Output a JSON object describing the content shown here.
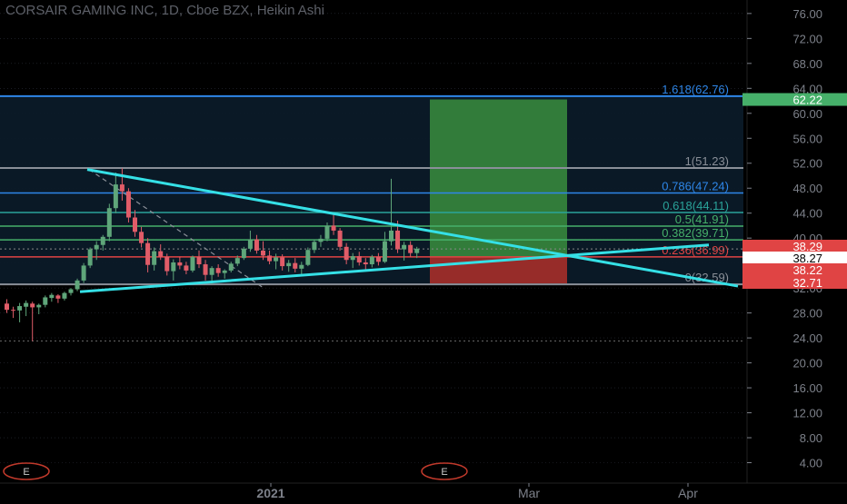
{
  "title": "CORSAIR GAMING INC, 1D, Cboe BZX, Heikin Ashi",
  "colors": {
    "background": "#000000",
    "up_candle": "#5fa67a",
    "down_candle": "#e05c68",
    "trendline": "#35e0e6",
    "fib_blue": "#2e86e8",
    "fib_gray": "#8a8f98",
    "fib_teal": "#2aa39a",
    "fib_green": "#46b06a",
    "fib_red": "#e04444",
    "target_zone": "#3a8e3e",
    "stop_zone": "#b0302a",
    "axis_text": "#7d818a",
    "grid": "#2a2e39"
  },
  "chart_data": {
    "type": "candlestick",
    "title": "CORSAIR GAMING INC, 1D, Cboe BZX, Heikin Ashi",
    "y_axis": {
      "ticks": [
        "76.00",
        "72.00",
        "68.00",
        "64.00",
        "60.00",
        "56.00",
        "52.00",
        "48.00",
        "44.00",
        "40.00",
        "36.00",
        "32.00",
        "28.00",
        "24.00",
        "20.00",
        "16.00",
        "12.00",
        "8.00",
        "4.00"
      ],
      "range": [
        0,
        78
      ]
    },
    "x_axis": {
      "ticks": [
        "2021",
        "Mar",
        "Apr"
      ]
    },
    "price_labels": [
      {
        "text": "62.22",
        "value": 62.22,
        "color": "#46b06a",
        "text_color": "#ffffff"
      },
      {
        "text": "38.29",
        "value": 38.29,
        "color": "#e04444",
        "text_color": "#ffffff"
      },
      {
        "text": "38.27",
        "value": 38.27,
        "color": "#ffffff",
        "text_color": "#000000"
      },
      {
        "text": "38.22",
        "value": 38.22,
        "color": "#e04444",
        "text_color": "#ffffff"
      },
      {
        "text": "32.71",
        "value": 32.71,
        "color": "#e04444",
        "text_color": "#ffffff"
      }
    ],
    "fib_levels": [
      {
        "label": "1.618(62.76)",
        "value": 62.76,
        "color": "#2e86e8"
      },
      {
        "label": "1(51.23)",
        "value": 51.23,
        "color": "#8a8f98"
      },
      {
        "label": "0.786(47.24)",
        "value": 47.24,
        "color": "#2e86e8"
      },
      {
        "label": "0.618(44.11)",
        "value": 44.11,
        "color": "#2aa39a"
      },
      {
        "label": "0.5(41.91)",
        "value": 41.91,
        "color": "#46b06a"
      },
      {
        "label": "0.382(39.71)",
        "value": 39.71,
        "color": "#46b06a"
      },
      {
        "label": "0.236(36.99)",
        "value": 36.99,
        "color": "#e04444"
      },
      {
        "label": "0(32.59)",
        "value": 32.59,
        "color": "#8a8f98"
      }
    ],
    "position": {
      "entry": 36.99,
      "target": 62.22,
      "stop": 32.71
    },
    "earnings_markers": [
      "E",
      "E"
    ],
    "candles": [
      {
        "o": 29.5,
        "h": 30.2,
        "l": 28.0,
        "c": 28.5
      },
      {
        "o": 28.5,
        "h": 29.0,
        "l": 27.2,
        "c": 28.4
      },
      {
        "o": 28.4,
        "h": 29.6,
        "l": 26.5,
        "c": 29.1
      },
      {
        "o": 29.0,
        "h": 30.0,
        "l": 27.5,
        "c": 29.6
      },
      {
        "o": 29.5,
        "h": 29.8,
        "l": 23.5,
        "c": 28.9
      },
      {
        "o": 28.9,
        "h": 29.5,
        "l": 27.8,
        "c": 29.3
      },
      {
        "o": 29.3,
        "h": 30.8,
        "l": 28.9,
        "c": 30.5
      },
      {
        "o": 30.4,
        "h": 31.2,
        "l": 29.8,
        "c": 30.9
      },
      {
        "o": 30.8,
        "h": 31.0,
        "l": 29.6,
        "c": 30.3
      },
      {
        "o": 30.3,
        "h": 31.4,
        "l": 30.0,
        "c": 31.2
      },
      {
        "o": 31.2,
        "h": 32.0,
        "l": 30.8,
        "c": 31.8
      },
      {
        "o": 31.8,
        "h": 33.5,
        "l": 31.5,
        "c": 33.2
      },
      {
        "o": 33.2,
        "h": 36.0,
        "l": 32.8,
        "c": 35.6
      },
      {
        "o": 35.6,
        "h": 38.5,
        "l": 35.2,
        "c": 38.2
      },
      {
        "o": 38.2,
        "h": 39.5,
        "l": 36.5,
        "c": 38.9
      },
      {
        "o": 38.9,
        "h": 40.5,
        "l": 38.0,
        "c": 40.2
      },
      {
        "o": 40.2,
        "h": 45.5,
        "l": 39.5,
        "c": 44.8
      },
      {
        "o": 44.8,
        "h": 50.5,
        "l": 44.0,
        "c": 48.6
      },
      {
        "o": 48.6,
        "h": 51.2,
        "l": 46.0,
        "c": 47.5
      },
      {
        "o": 47.5,
        "h": 48.0,
        "l": 42.5,
        "c": 43.3
      },
      {
        "o": 43.3,
        "h": 44.5,
        "l": 40.2,
        "c": 41.0
      },
      {
        "o": 41.0,
        "h": 41.8,
        "l": 38.5,
        "c": 39.2
      },
      {
        "o": 39.2,
        "h": 40.0,
        "l": 34.5,
        "c": 35.7
      },
      {
        "o": 35.7,
        "h": 38.5,
        "l": 34.8,
        "c": 37.9
      },
      {
        "o": 37.9,
        "h": 39.0,
        "l": 36.5,
        "c": 37.0
      },
      {
        "o": 37.0,
        "h": 37.5,
        "l": 34.0,
        "c": 34.7
      },
      {
        "o": 34.7,
        "h": 36.6,
        "l": 33.2,
        "c": 36.1
      },
      {
        "o": 36.1,
        "h": 37.0,
        "l": 35.0,
        "c": 35.6
      },
      {
        "o": 35.6,
        "h": 36.2,
        "l": 34.2,
        "c": 34.8
      },
      {
        "o": 34.8,
        "h": 37.2,
        "l": 34.5,
        "c": 37.0
      },
      {
        "o": 37.0,
        "h": 38.0,
        "l": 35.2,
        "c": 35.8
      },
      {
        "o": 35.8,
        "h": 36.5,
        "l": 33.2,
        "c": 34.1
      },
      {
        "o": 34.1,
        "h": 35.5,
        "l": 32.6,
        "c": 35.2
      },
      {
        "o": 35.2,
        "h": 35.8,
        "l": 33.8,
        "c": 34.4
      },
      {
        "o": 34.4,
        "h": 35.0,
        "l": 33.5,
        "c": 34.8
      },
      {
        "o": 34.8,
        "h": 36.2,
        "l": 34.5,
        "c": 35.9
      },
      {
        "o": 35.9,
        "h": 37.2,
        "l": 35.5,
        "c": 36.8
      },
      {
        "o": 36.8,
        "h": 38.6,
        "l": 36.5,
        "c": 38.3
      },
      {
        "o": 38.3,
        "h": 41.2,
        "l": 37.8,
        "c": 39.8
      },
      {
        "o": 39.8,
        "h": 40.5,
        "l": 37.5,
        "c": 38.0
      },
      {
        "o": 38.0,
        "h": 39.5,
        "l": 36.5,
        "c": 37.2
      },
      {
        "o": 37.2,
        "h": 38.0,
        "l": 35.8,
        "c": 36.3
      },
      {
        "o": 36.3,
        "h": 37.5,
        "l": 35.0,
        "c": 36.9
      },
      {
        "o": 36.9,
        "h": 37.4,
        "l": 34.8,
        "c": 35.5
      },
      {
        "o": 35.5,
        "h": 36.5,
        "l": 34.6,
        "c": 36.0
      },
      {
        "o": 36.0,
        "h": 36.8,
        "l": 34.5,
        "c": 35.1
      },
      {
        "o": 35.1,
        "h": 36.2,
        "l": 34.0,
        "c": 35.7
      },
      {
        "o": 35.7,
        "h": 38.5,
        "l": 35.5,
        "c": 38.1
      },
      {
        "o": 38.1,
        "h": 39.8,
        "l": 37.6,
        "c": 39.4
      },
      {
        "o": 39.4,
        "h": 40.5,
        "l": 38.6,
        "c": 39.9
      },
      {
        "o": 39.9,
        "h": 42.5,
        "l": 39.5,
        "c": 42.0
      },
      {
        "o": 42.0,
        "h": 43.8,
        "l": 40.5,
        "c": 41.2
      },
      {
        "o": 41.2,
        "h": 41.6,
        "l": 38.0,
        "c": 38.6
      },
      {
        "o": 38.6,
        "h": 39.2,
        "l": 35.8,
        "c": 36.5
      },
      {
        "o": 36.5,
        "h": 37.6,
        "l": 35.2,
        "c": 37.1
      },
      {
        "o": 37.1,
        "h": 37.8,
        "l": 35.6,
        "c": 36.1
      },
      {
        "o": 36.1,
        "h": 36.8,
        "l": 35.0,
        "c": 35.8
      },
      {
        "o": 35.8,
        "h": 37.3,
        "l": 35.3,
        "c": 37.0
      },
      {
        "o": 37.0,
        "h": 37.6,
        "l": 35.6,
        "c": 36.2
      },
      {
        "o": 36.2,
        "h": 41.0,
        "l": 36.0,
        "c": 39.5
      },
      {
        "o": 39.5,
        "h": 49.5,
        "l": 38.8,
        "c": 41.2
      },
      {
        "o": 41.2,
        "h": 42.8,
        "l": 37.6,
        "c": 38.2
      },
      {
        "o": 38.2,
        "h": 39.4,
        "l": 36.4,
        "c": 38.9
      },
      {
        "o": 38.9,
        "h": 39.5,
        "l": 37.0,
        "c": 37.6
      },
      {
        "o": 37.6,
        "h": 38.6,
        "l": 36.8,
        "c": 38.3
      }
    ]
  }
}
